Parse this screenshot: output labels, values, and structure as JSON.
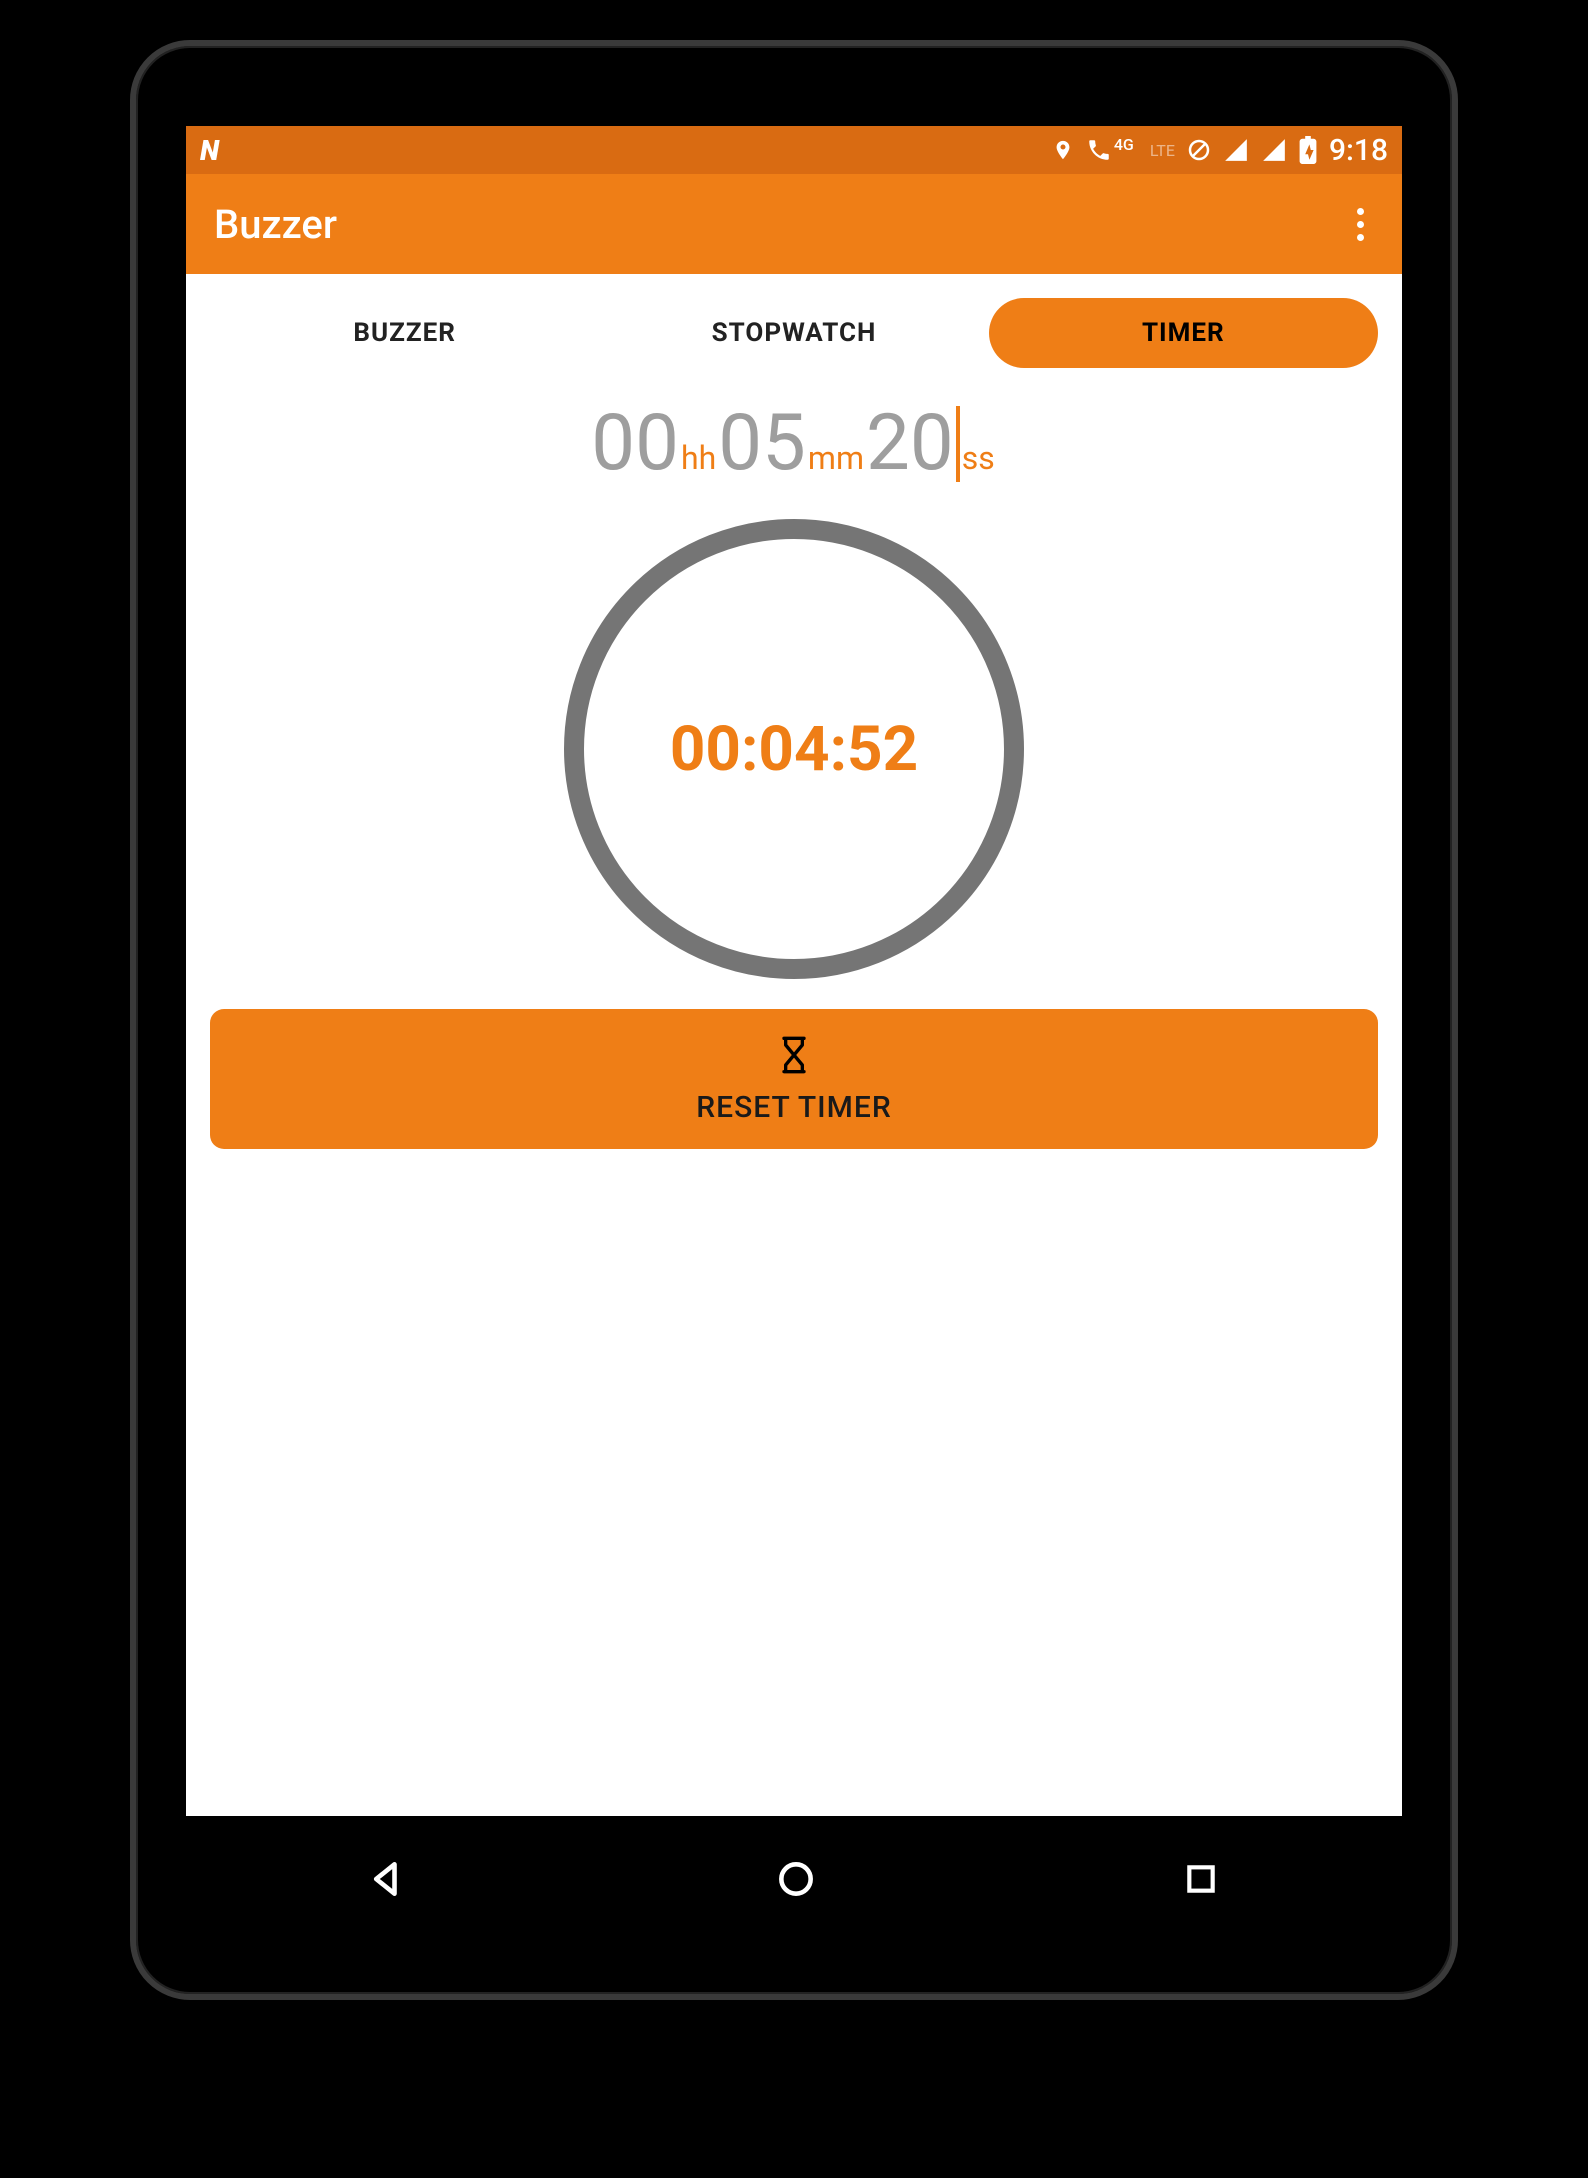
{
  "status": {
    "logo": "N",
    "network_label_4g": "4G",
    "network_label_lte": "LTE",
    "time": "9:18"
  },
  "appbar": {
    "title": "Buzzer"
  },
  "tabs": {
    "items": [
      {
        "label": "BUZZER",
        "active": false
      },
      {
        "label": "STOPWATCH",
        "active": false
      },
      {
        "label": "TIMER",
        "active": true
      }
    ]
  },
  "timer_input": {
    "hours": "00",
    "hours_unit": "hh",
    "minutes": "05",
    "minutes_unit": "mm",
    "seconds": "20",
    "seconds_unit": "ss"
  },
  "timer_display": {
    "elapsed": "00:04:52"
  },
  "reset_button": {
    "icon": "⌛",
    "label": "RESET TIMER"
  },
  "colors": {
    "primary": "#ef7e16",
    "primary_dark": "#d96b12",
    "grey_text": "#9e9e9e",
    "circle_border": "#757575"
  }
}
